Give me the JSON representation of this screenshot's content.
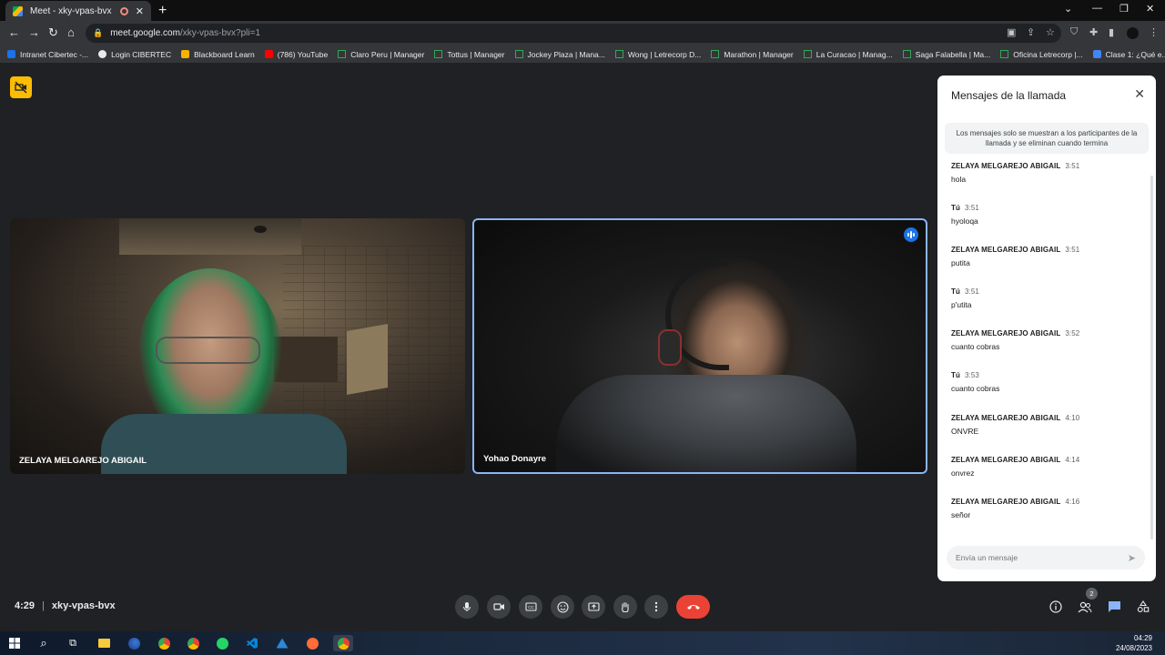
{
  "browser": {
    "tab_title": "Meet - xky-vpas-bvx",
    "tab_close": "✕",
    "new_tab": "+",
    "url_host": "meet.google.com",
    "url_path": "/xky-vpas-bvx?pli=1",
    "bookmarks": [
      {
        "label": "Intranet Cibertec -...",
        "color": "#1a73e8"
      },
      {
        "label": "Login CIBERTEC",
        "color": "#e8eaed"
      },
      {
        "label": "Blackboard Learn",
        "color": "#f4b400"
      },
      {
        "label": "(786) YouTube",
        "color": "#ff0000"
      },
      {
        "label": "Claro Peru | Manager",
        "color": "#34a853"
      },
      {
        "label": "Tottus | Manager",
        "color": "#34a853"
      },
      {
        "label": "Jockey Plaza | Mana...",
        "color": "#34a853"
      },
      {
        "label": "Wong | Letrecorp D...",
        "color": "#34a853"
      },
      {
        "label": "Marathon | Manager",
        "color": "#34a853"
      },
      {
        "label": "La Curacao | Manag...",
        "color": "#34a853"
      },
      {
        "label": "Saga Falabella | Ma...",
        "color": "#34a853"
      },
      {
        "label": "Oficina Letrecorp |...",
        "color": "#34a853"
      },
      {
        "label": "Clase 1: ¿Qué e...",
        "color": "#4285f4"
      }
    ]
  },
  "participants": [
    {
      "name": "ZELAYA MELGAREJO ABIGAIL"
    },
    {
      "name": "Yohao Donayre"
    }
  ],
  "chat": {
    "title": "Mensajes de la llamada",
    "notice": "Los mensajes solo se muestran a los participantes de la llamada y se eliminan cuando termina",
    "input_placeholder": "Envía un mensaje",
    "messages": [
      {
        "sender": "ZELAYA MELGAREJO ABIGAIL",
        "time": "3:51",
        "text": "hola"
      },
      {
        "sender": "Tú",
        "time": "3:51",
        "text": "hyoloqa"
      },
      {
        "sender": "ZELAYA MELGAREJO ABIGAIL",
        "time": "3:51",
        "text": "putita"
      },
      {
        "sender": "Tú",
        "time": "3:51",
        "text": "p'utita"
      },
      {
        "sender": "ZELAYA MELGAREJO ABIGAIL",
        "time": "3:52",
        "text": "cuanto cobras"
      },
      {
        "sender": "Tú",
        "time": "3:53",
        "text": "cuanto cobras"
      },
      {
        "sender": "ZELAYA MELGAREJO ABIGAIL",
        "time": "4:10",
        "text": "ONVRE"
      },
      {
        "sender": "ZELAYA MELGAREJO ABIGAIL",
        "time": "4:14",
        "text": "onvrez"
      },
      {
        "sender": "ZELAYA MELGAREJO ABIGAIL",
        "time": "4:16",
        "text": "señor"
      }
    ]
  },
  "meeting": {
    "time": "4:29",
    "code": "xky-vpas-bvx",
    "participant_count": "2"
  },
  "taskbar": {
    "time": "04:29",
    "date": "24/08/2023"
  },
  "colors": {
    "hangup": "#ea4335",
    "active_speaker_border": "#8ab4f8",
    "chat_active": "#8ab4f8",
    "cam_off_badge": "#fbbc04"
  }
}
